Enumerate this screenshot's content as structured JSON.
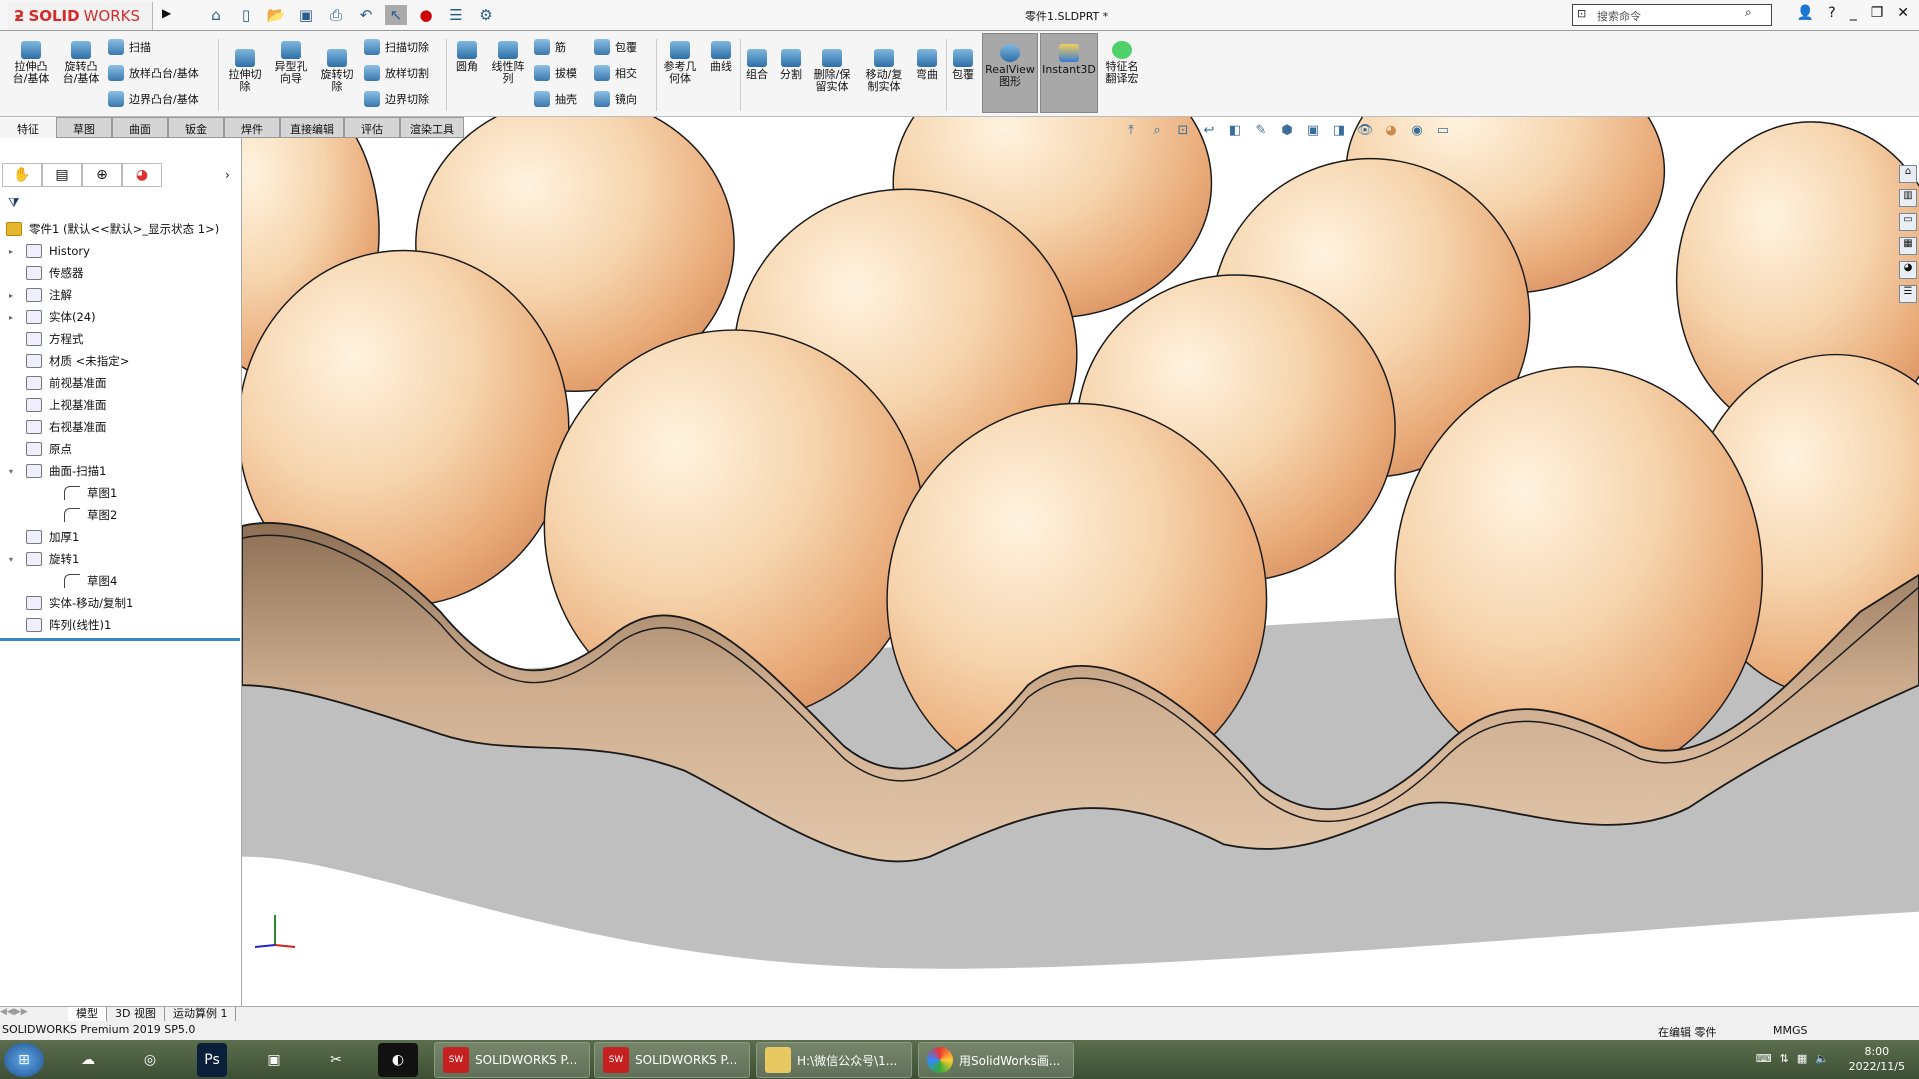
{
  "app": {
    "brand_bold": "SOLID",
    "brand_light": "WORKS",
    "doc_title": "零件1.SLDPRT *",
    "search_placeholder": "搜索命令"
  },
  "quick_access": [
    "home-icon",
    "new-icon",
    "open-icon",
    "save-icon",
    "print-icon",
    "undo-icon",
    "select-icon",
    "rebuild-icon",
    "file-properties-icon",
    "options-icon"
  ],
  "ribbon": {
    "extrude_boss": "拉伸凸\n台/基体",
    "revolve_boss": "旋转凸\n台/基体",
    "sweep": "扫描",
    "loft": "放样凸台/基体",
    "boundary": "边界凸台/基体",
    "extrude_cut": "拉伸切\n除",
    "hole_wizard": "异型孔\n向导",
    "revolve_cut": "旋转切\n除",
    "swept_cut": "扫描切除",
    "lofted_cut": "放样切割",
    "boundary_cut": "边界切除",
    "fillet": "圆角",
    "linear_pattern": "线性阵\n列",
    "rib": "筋",
    "draft": "拔模",
    "shell": "抽壳",
    "wrap": "包覆",
    "intersect": "相交",
    "mirror": "镜向",
    "ref_geometry": "参考几\n何体",
    "curves": "曲线",
    "combine": "组合",
    "split": "分割",
    "delete_keep": "删除/保\n留实体",
    "move_copy": "移动/复\n制实体",
    "flex": "弯曲",
    "wrap2": "包覆",
    "realview": "RealView\n图形",
    "instant3d": "Instant3D",
    "feature_translate": "特征名\n翻译宏"
  },
  "tabs": [
    "特征",
    "草图",
    "曲面",
    "钣金",
    "焊件",
    "直接编辑",
    "评估",
    "渲染工具"
  ],
  "tree": [
    {
      "label": "零件1 (默认<<默认>_显示状态 1>)",
      "level": "root",
      "icon": "part-icon"
    },
    {
      "label": "History",
      "level": "l1",
      "expand": "▸",
      "icon": "history-folder-icon"
    },
    {
      "label": "传感器",
      "level": "l1",
      "expand": "",
      "icon": "sensor-folder-icon"
    },
    {
      "label": "注解",
      "level": "l1",
      "expand": "▸",
      "icon": "annotation-folder-icon"
    },
    {
      "label": "实体(24)",
      "level": "l1",
      "expand": "▸",
      "icon": "solid-bodies-icon"
    },
    {
      "label": "方程式",
      "level": "l1",
      "expand": "",
      "icon": "equations-icon"
    },
    {
      "label": "材质 <未指定>",
      "level": "l1",
      "expand": "",
      "icon": "material-icon"
    },
    {
      "label": "前视基准面",
      "level": "l1",
      "expand": "",
      "icon": "plane-icon"
    },
    {
      "label": "上视基准面",
      "level": "l1",
      "expand": "",
      "icon": "plane-icon"
    },
    {
      "label": "右视基准面",
      "level": "l1",
      "expand": "",
      "icon": "plane-icon"
    },
    {
      "label": "原点",
      "level": "l1",
      "expand": "",
      "icon": "origin-icon"
    },
    {
      "label": "曲面-扫描1",
      "level": "l1",
      "expand": "▾",
      "icon": "surface-sweep-icon"
    },
    {
      "label": "草图1",
      "level": "l2",
      "expand": "",
      "icon": "sketch-icon"
    },
    {
      "label": "草图2",
      "level": "l2",
      "expand": "",
      "icon": "sketch-icon"
    },
    {
      "label": "加厚1",
      "level": "l1",
      "expand": "",
      "icon": "thicken-icon"
    },
    {
      "label": "旋转1",
      "level": "l1",
      "expand": "▾",
      "icon": "revolve-icon"
    },
    {
      "label": "草图4",
      "level": "l2",
      "expand": "",
      "icon": "sketch-icon"
    },
    {
      "label": "实体-移动/复制1",
      "level": "l1",
      "expand": "",
      "icon": "move-copy-icon"
    },
    {
      "label": "阵列(线性)1",
      "level": "l1",
      "expand": "",
      "icon": "linear-pattern-icon"
    }
  ],
  "bottom_tabs": [
    "模型",
    "3D 视图",
    "运动算例 1"
  ],
  "status": {
    "product": "SOLIDWORKS Premium 2019 SP5.0",
    "mode": "在编辑 零件",
    "units": "MMGS"
  },
  "taskbar": {
    "windows": [
      "SOLIDWORKS P...",
      "SOLIDWORKS P...",
      "H:\\微信公众号\\1...",
      "用SolidWorks画..."
    ],
    "time": "8:00",
    "date": "2022/11/5"
  },
  "colors": {
    "brand": "#d52b2b",
    "egg": "#f2c9a0",
    "tray": "#c9a585",
    "shadow": "#bdbdbd"
  }
}
